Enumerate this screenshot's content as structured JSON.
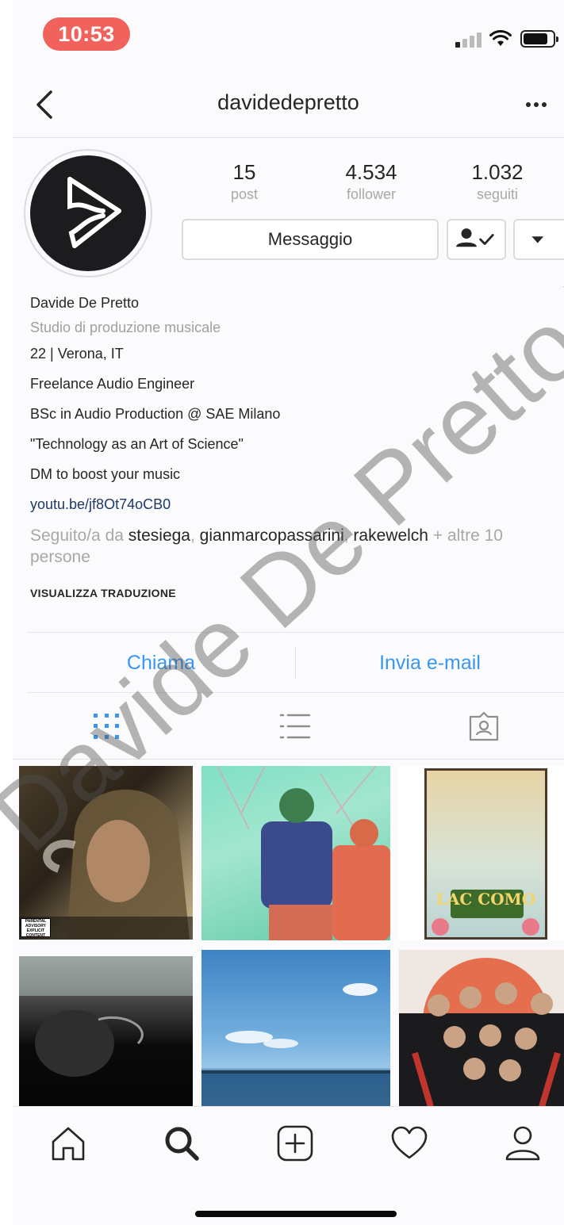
{
  "status_bar": {
    "time": "10:53"
  },
  "header": {
    "username": "davidedepretto"
  },
  "profile": {
    "stats": [
      {
        "value": "15",
        "label": "post"
      },
      {
        "value": "4.534",
        "label": "follower"
      },
      {
        "value": "1.032",
        "label": "seguiti"
      }
    ],
    "message_button": "Messaggio",
    "name": "Davide De Pretto",
    "category": "Studio di produzione musicale",
    "bio_lines": [
      "22 | Verona, IT",
      "Freelance Audio Engineer",
      "BSc in Audio Production @ SAE Milano",
      "\"Technology as an Art of Science\"",
      "DM to boost your music"
    ],
    "link": "youtu.be/jf8Ot74oCB0",
    "followed_by": {
      "prefix": "Seguito/a da ",
      "users": [
        "stesiega",
        "gianmarcopassarini",
        "rakewelch"
      ],
      "separator": ", ",
      "suffix": " + altre 10 persone"
    },
    "translate": "VISUALIZZA TRADUZIONE"
  },
  "contact": {
    "call": "Chiama",
    "email": "Invia e-mail"
  },
  "tabs": [
    {
      "icon": "grid-icon",
      "active": true
    },
    {
      "icon": "list-icon",
      "active": false
    },
    {
      "icon": "tagged-icon",
      "active": false
    }
  ],
  "posts": [
    {
      "caption_overlay": "PARENTAL ADVISORY EXPLICIT CONTENT"
    },
    {
      "caption_overlay": ""
    },
    {
      "caption_overlay": "LAC COMO"
    },
    {
      "caption_overlay": ""
    },
    {
      "caption_overlay": ""
    },
    {
      "caption_overlay": ""
    }
  ],
  "tab_bar": [
    "home-icon",
    "search-icon",
    "add-post-icon",
    "activity-heart-icon",
    "profile-icon"
  ],
  "watermark": "Davide De Pretto Tommaso",
  "colors": {
    "accent": "#3897f0",
    "time_pill": "#f0625b",
    "link": "#1d3a66"
  }
}
